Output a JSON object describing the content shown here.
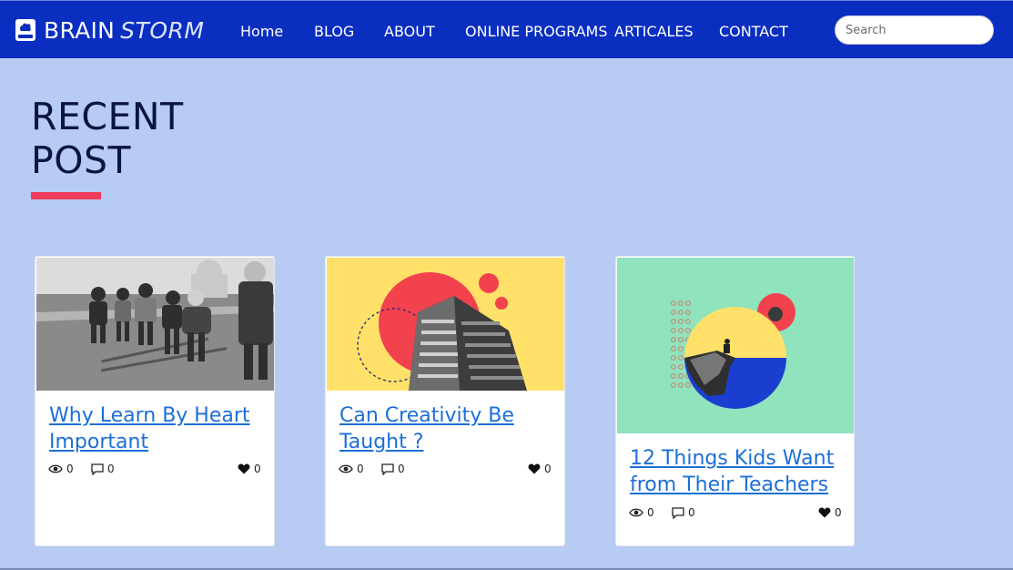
{
  "brand": {
    "name_first": "BRAIN",
    "name_second": "STORM",
    "logo_icon": "book-brain-icon"
  },
  "nav": {
    "items": [
      {
        "label": "Home"
      },
      {
        "label": "BLOG"
      },
      {
        "label": "ABOUT"
      },
      {
        "label": "ONLINE PROGRAMS"
      },
      {
        "label": "ARTICALES"
      },
      {
        "label": "CONTACT"
      }
    ]
  },
  "search": {
    "placeholder": "Search",
    "value": ""
  },
  "section": {
    "heading_line1": "RECENT",
    "heading_line2": "POST"
  },
  "posts": [
    {
      "title": "Why Learn By Heart Important",
      "views": "0",
      "comments": "0",
      "likes": "0",
      "image": "children-playing-bw-photo"
    },
    {
      "title": "Can Creativity Be Taught ?",
      "views": "0",
      "comments": "0",
      "likes": "0",
      "image": "building-collage-yellow"
    },
    {
      "title": "12 Things Kids Want from Their Teachers",
      "views": "0",
      "comments": "0",
      "likes": "0",
      "image": "cliff-collage-green"
    }
  ],
  "colors": {
    "navbar": "#0a2ec0",
    "page_bg": "#b8cbf2",
    "heading": "#0b1540",
    "accent_bar": "#f03d5a",
    "link": "#1c6fd6"
  }
}
